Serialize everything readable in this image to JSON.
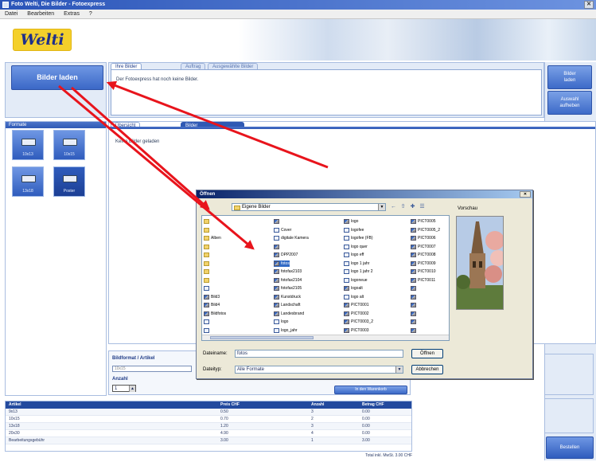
{
  "window": {
    "title": "Foto Welti, Die Bilder - Fotoexpress"
  },
  "menu": [
    "Datei",
    "Bearbeiten",
    "Extras",
    "?"
  ],
  "logo": {
    "text": "Welti"
  },
  "load_button": {
    "label": "Bilder laden"
  },
  "message_panel": {
    "tabs": [
      "Ihre Bilder",
      "Auftrag",
      "Ausgewählte Bilder"
    ],
    "text": "Der Fotoexpress hat noch keine Bilder."
  },
  "side_buttons": [
    {
      "line1": "Bilder",
      "line2": "laden"
    },
    {
      "line1": "Auswahl",
      "line2": "aufheben"
    }
  ],
  "formats": {
    "header": "Formate",
    "tiles": [
      {
        "label": "10x13"
      },
      {
        "label": "10x15"
      },
      {
        "label": "13x18"
      },
      {
        "label": "Poster"
      }
    ],
    "selected_index": 3
  },
  "work_panel": {
    "tabs": [
      "Übersicht",
      "Bilder"
    ],
    "text": "Keine Bilder geladen"
  },
  "dialog": {
    "title": "Öffnen",
    "look_in": "Eigene Bilder",
    "preview_label": "Vorschau",
    "files": [
      {
        "name": "",
        "type": "folder",
        "col": 0,
        "row": 0
      },
      {
        "name": "",
        "type": "folder",
        "col": 0,
        "row": 1
      },
      {
        "name": "Alben",
        "type": "folder",
        "col": 0,
        "row": 2
      },
      {
        "name": "",
        "type": "folder",
        "col": 0,
        "row": 3
      },
      {
        "name": "",
        "type": "folder",
        "col": 0,
        "row": 4
      },
      {
        "name": "",
        "type": "folder",
        "col": 0,
        "row": 5
      },
      {
        "name": "",
        "type": "folder",
        "col": 0,
        "row": 6
      },
      {
        "name": "",
        "type": "folder",
        "col": 0,
        "row": 7
      },
      {
        "name": "",
        "type": "doc",
        "col": 0,
        "row": 8
      },
      {
        "name": "Bild3",
        "type": "img",
        "col": 0,
        "row": 9
      },
      {
        "name": "Bild4",
        "type": "img",
        "col": 0,
        "row": 10
      },
      {
        "name": "Bildfotos",
        "type": "img",
        "col": 0,
        "row": 11
      },
      {
        "name": "",
        "type": "doc",
        "col": 0,
        "row": 12
      },
      {
        "name": "",
        "type": "doc",
        "col": 0,
        "row": 13
      },
      {
        "name": "",
        "type": "img",
        "col": 1,
        "row": 0
      },
      {
        "name": "Cover",
        "type": "doc",
        "col": 1,
        "row": 1
      },
      {
        "name": "digitale Kamera",
        "type": "doc",
        "col": 1,
        "row": 2
      },
      {
        "name": "",
        "type": "img",
        "col": 1,
        "row": 3
      },
      {
        "name": "DPP2007",
        "type": "img",
        "col": 1,
        "row": 4
      },
      {
        "name": "fotos",
        "type": "img",
        "col": 1,
        "row": 5
      },
      {
        "name": "fotofax2103",
        "type": "img",
        "col": 1,
        "row": 6
      },
      {
        "name": "fotofax2104",
        "type": "img",
        "col": 1,
        "row": 7
      },
      {
        "name": "fotofax2105",
        "type": "img",
        "col": 1,
        "row": 8
      },
      {
        "name": "Kunstdruck",
        "type": "img",
        "col": 1,
        "row": 9
      },
      {
        "name": "Landschaft",
        "type": "img",
        "col": 1,
        "row": 10
      },
      {
        "name": "Landesbrand",
        "type": "img",
        "col": 1,
        "row": 11
      },
      {
        "name": "logo",
        "type": "doc",
        "col": 1,
        "row": 12
      },
      {
        "name": "logo_jahr",
        "type": "doc",
        "col": 1,
        "row": 13
      },
      {
        "name": "logo",
        "type": "img",
        "col": 2,
        "row": 0
      },
      {
        "name": "logofee",
        "type": "doc",
        "col": 2,
        "row": 1
      },
      {
        "name": "logofee (FB)",
        "type": "doc",
        "col": 2,
        "row": 2
      },
      {
        "name": "logo quer",
        "type": "doc",
        "col": 2,
        "row": 3
      },
      {
        "name": "logo eff",
        "type": "doc",
        "col": 2,
        "row": 4
      },
      {
        "name": "logo 1 jahr",
        "type": "doc",
        "col": 2,
        "row": 5
      },
      {
        "name": "logo 1 jahr 2",
        "type": "doc",
        "col": 2,
        "row": 6
      },
      {
        "name": "logoneue",
        "type": "doc",
        "col": 2,
        "row": 7
      },
      {
        "name": "logoalt",
        "type": "img",
        "col": 2,
        "row": 8
      },
      {
        "name": "logo alt",
        "type": "doc",
        "col": 2,
        "row": 9
      },
      {
        "name": "PICT0001",
        "type": "img",
        "col": 2,
        "row": 10
      },
      {
        "name": "PICT0002",
        "type": "img",
        "col": 2,
        "row": 11
      },
      {
        "name": "PICT0003_2",
        "type": "img",
        "col": 2,
        "row": 12
      },
      {
        "name": "PICT0003",
        "type": "img",
        "col": 2,
        "row": 13
      },
      {
        "name": "PICT0005",
        "type": "img",
        "col": 3,
        "row": 0
      },
      {
        "name": "PICT0005_2",
        "type": "img",
        "col": 3,
        "row": 1
      },
      {
        "name": "PICT0006",
        "type": "img",
        "col": 3,
        "row": 2
      },
      {
        "name": "PICT0007",
        "type": "img",
        "col": 3,
        "row": 3
      },
      {
        "name": "PICT0008",
        "type": "img",
        "col": 3,
        "row": 4
      },
      {
        "name": "PICT0009",
        "type": "img",
        "col": 3,
        "row": 5
      },
      {
        "name": "PICT0010",
        "type": "img",
        "col": 3,
        "row": 6
      },
      {
        "name": "PICT0011",
        "type": "img",
        "col": 3,
        "row": 7
      },
      {
        "name": "",
        "type": "img",
        "col": 3,
        "row": 8
      },
      {
        "name": "",
        "type": "img",
        "col": 3,
        "row": 9
      },
      {
        "name": "",
        "type": "img",
        "col": 3,
        "row": 10
      },
      {
        "name": "",
        "type": "img",
        "col": 3,
        "row": 11
      },
      {
        "name": "",
        "type": "img",
        "col": 3,
        "row": 12
      },
      {
        "name": "",
        "type": "img",
        "col": 3,
        "row": 13
      }
    ],
    "selected_file": "fotos",
    "filename_label": "Dateiname:",
    "filename_value": "fotos",
    "filetype_label": "Dateityp:",
    "filetype_value": "Alle Formate",
    "open_button": "Öffnen",
    "cancel_button": "Abbrechen"
  },
  "order_form": {
    "format_label": "Bildformat / Artikel",
    "format_placeholder": "10x15",
    "qty_label": "Anzahl",
    "qty_value": "1",
    "add_button": "In den Warenkorb"
  },
  "order_table": {
    "columns": [
      "Artikel",
      "Preis CHF",
      "Anzahl",
      "Betrag CHF"
    ],
    "rows": [
      [
        "9x13",
        "0.50",
        "3",
        "0.00"
      ],
      [
        "10x15",
        "0.70",
        "2",
        "0.00"
      ],
      [
        "13x18",
        "1.20",
        "3",
        "0.00"
      ],
      [
        "20x30",
        "4.90",
        "4",
        "0.00"
      ],
      [
        "Bearbeitungsgebühr",
        "3.00",
        "1",
        "3.00"
      ]
    ],
    "total": "Total inkl. MwSt. 3.00 CHF"
  },
  "order_button": {
    "label": "Bestellen"
  },
  "colors": {
    "accent": "#2f59b4",
    "arrow": "#e8141c",
    "logo_bg": "#f4d02a"
  }
}
